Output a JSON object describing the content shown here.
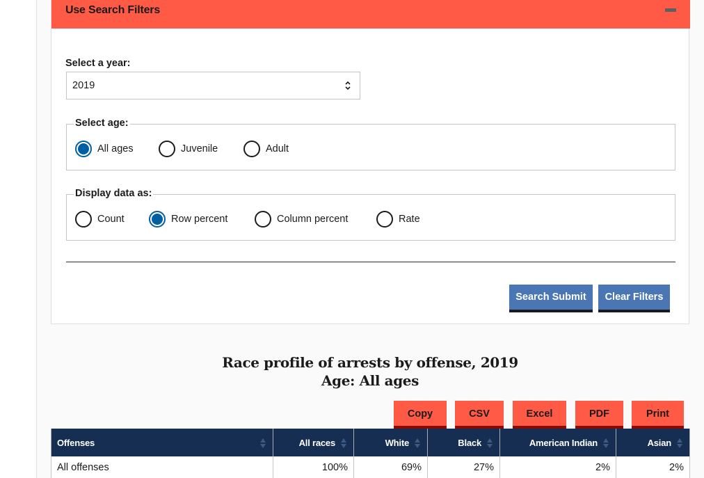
{
  "filters": {
    "title": "Use Search Filters",
    "collapse_icon": "minus-icon",
    "year": {
      "label": "Select a year:",
      "value": "2019"
    },
    "age": {
      "legend": "Select age:",
      "options": [
        {
          "label": "All ages",
          "checked": true
        },
        {
          "label": "Juvenile",
          "checked": false
        },
        {
          "label": "Adult",
          "checked": false
        }
      ]
    },
    "display": {
      "legend": "Display data as:",
      "options": [
        {
          "label": "Count",
          "checked": false
        },
        {
          "label": "Row percent",
          "checked": true
        },
        {
          "label": "Column percent",
          "checked": false
        },
        {
          "label": "Rate",
          "checked": false
        }
      ]
    },
    "buttons": {
      "submit": "Search Submit",
      "clear": "Clear Filters"
    }
  },
  "report": {
    "title": "Race profile of arrests by offense, 2019",
    "subtitle": "Age: All ages",
    "export_buttons": [
      "Copy",
      "CSV",
      "Excel",
      "PDF",
      "Print"
    ],
    "table": {
      "columns": [
        "Offenses",
        "All races",
        "White",
        "Black",
        "American Indian",
        "Asian"
      ],
      "rows": [
        [
          "All offenses",
          "100%",
          "69%",
          "27%",
          "2%",
          "2%"
        ]
      ]
    }
  },
  "colors": {
    "header_accent": "#fe5a45",
    "primary_button": "#4a77b4",
    "table_header": "#162e51",
    "radio_checked": "#005ea2"
  }
}
